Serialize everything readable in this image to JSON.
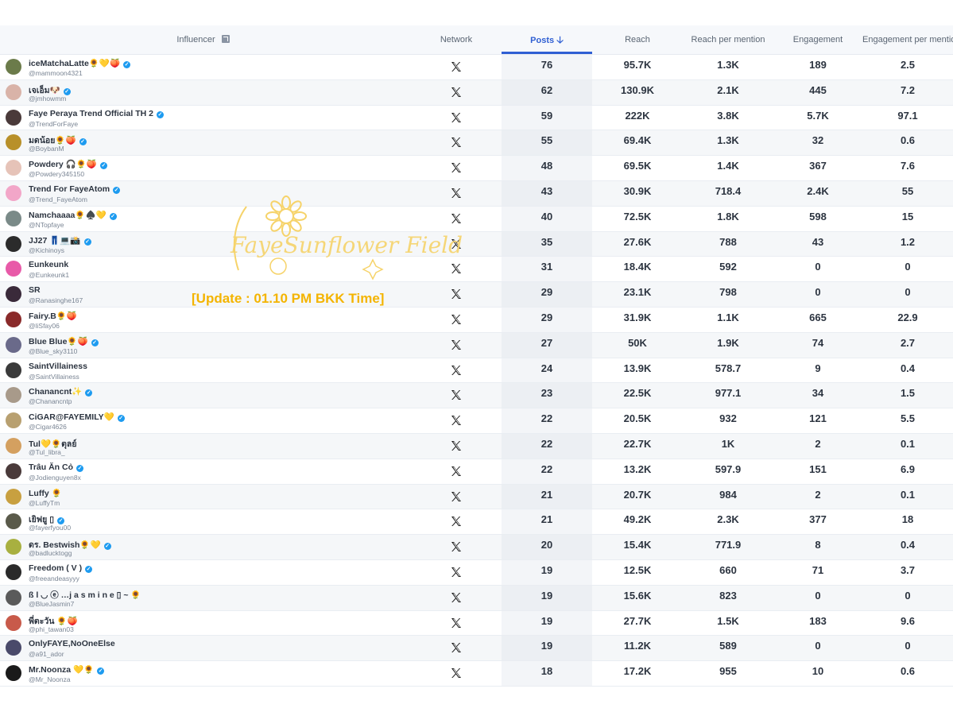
{
  "header": {
    "influencer": "Influencer",
    "network": "Network",
    "posts": "Posts",
    "reach": "Reach",
    "reach_per_mention": "Reach per mention",
    "engagement": "Engagement",
    "engagement_per_mention": "Engagement per mention"
  },
  "watermark": {
    "script_text": "FayeSunflower Field",
    "update_text": "[Update : 01.10 PM BKK Time]"
  },
  "network_icon": "x-logo-icon",
  "colors": {
    "accent": "#2f5fd3",
    "verified": "#1d9bf0",
    "update_text": "#f4b400"
  },
  "rows": [
    {
      "name": "iceMatchaLatte🌻💛🍑",
      "handle": "@mammoon4321",
      "verified": true,
      "posts": "76",
      "reach": "95.7K",
      "rpm": "1.3K",
      "eng": "189",
      "epm": "2.5",
      "avatar": "#6b7b4a"
    },
    {
      "name": "เจเอ็ม🐶",
      "handle": "@jmhowmm",
      "verified": true,
      "posts": "62",
      "reach": "130.9K",
      "rpm": "2.1K",
      "eng": "445",
      "epm": "7.2",
      "avatar": "#d9b3a8"
    },
    {
      "name": "Faye Peraya Trend Official TH 2",
      "handle": "@TrendForFaye",
      "verified": true,
      "posts": "59",
      "reach": "222K",
      "rpm": "3.8K",
      "eng": "5.7K",
      "epm": "97.1",
      "avatar": "#4a3a3a"
    },
    {
      "name": "มดน้อย🌻🍑",
      "handle": "@BoybanM",
      "verified": true,
      "posts": "55",
      "reach": "69.4K",
      "rpm": "1.3K",
      "eng": "32",
      "epm": "0.6",
      "avatar": "#b8902a"
    },
    {
      "name": "Powdery 🎧🌻🍑",
      "handle": "@Powdery345150",
      "verified": true,
      "posts": "48",
      "reach": "69.5K",
      "rpm": "1.4K",
      "eng": "367",
      "epm": "7.6",
      "avatar": "#e6c3b8"
    },
    {
      "name": "Trend For FayeAtom",
      "handle": "@Trend_FayeAtom",
      "verified": true,
      "posts": "43",
      "reach": "30.9K",
      "rpm": "718.4",
      "eng": "2.4K",
      "epm": "55",
      "avatar": "#f2a6c8"
    },
    {
      "name": "Namchaaaa🌻♠️💛",
      "handle": "@NTopfaye",
      "verified": true,
      "posts": "40",
      "reach": "72.5K",
      "rpm": "1.8K",
      "eng": "598",
      "epm": "15",
      "avatar": "#7a8a88"
    },
    {
      "name": "JJ27 👖💻📸",
      "handle": "@Kichinoys",
      "verified": true,
      "posts": "35",
      "reach": "27.6K",
      "rpm": "788",
      "eng": "43",
      "epm": "1.2",
      "avatar": "#2b2b2b"
    },
    {
      "name": "Eunkeunk",
      "handle": "@Eunkeunk1",
      "verified": false,
      "posts": "31",
      "reach": "18.4K",
      "rpm": "592",
      "eng": "0",
      "epm": "0",
      "avatar": "#e85aa8"
    },
    {
      "name": "SR",
      "handle": "@Ranasinghe167",
      "verified": false,
      "posts": "29",
      "reach": "23.1K",
      "rpm": "798",
      "eng": "0",
      "epm": "0",
      "avatar": "#3a2a3a"
    },
    {
      "name": "Fairy.B🌻🍑",
      "handle": "@liSfay06",
      "verified": false,
      "posts": "29",
      "reach": "31.9K",
      "rpm": "1.1K",
      "eng": "665",
      "epm": "22.9",
      "avatar": "#8a2a2a"
    },
    {
      "name": "Blue Blue🌻🍑",
      "handle": "@Blue_sky3110",
      "verified": true,
      "posts": "27",
      "reach": "50K",
      "rpm": "1.9K",
      "eng": "74",
      "epm": "2.7",
      "avatar": "#6a6a8a"
    },
    {
      "name": "SaintVillainess",
      "handle": "@SaintVillainess",
      "verified": false,
      "posts": "24",
      "reach": "13.9K",
      "rpm": "578.7",
      "eng": "9",
      "epm": "0.4",
      "avatar": "#3a3a3a"
    },
    {
      "name": "Chanancnt✨",
      "handle": "@Chanancntp",
      "verified": true,
      "posts": "23",
      "reach": "22.5K",
      "rpm": "977.1",
      "eng": "34",
      "epm": "1.5",
      "avatar": "#a89a8a"
    },
    {
      "name": "CiGAR@FAYEMILY💛",
      "handle": "@Cigar4626",
      "verified": true,
      "posts": "22",
      "reach": "20.5K",
      "rpm": "932",
      "eng": "121",
      "epm": "5.5",
      "avatar": "#b8a070"
    },
    {
      "name": "Tul💛🌻ตุลย์",
      "handle": "@Tul_libra_",
      "verified": false,
      "posts": "22",
      "reach": "22.7K",
      "rpm": "1K",
      "eng": "2",
      "epm": "0.1",
      "avatar": "#d4a060"
    },
    {
      "name": "Trâu Ăn Cỏ",
      "handle": "@Jodienguyen8x",
      "verified": true,
      "posts": "22",
      "reach": "13.2K",
      "rpm": "597.9",
      "eng": "151",
      "epm": "6.9",
      "avatar": "#4a3a3a"
    },
    {
      "name": "Luffy 🌻",
      "handle": "@LuffyTm",
      "verified": false,
      "posts": "21",
      "reach": "20.7K",
      "rpm": "984",
      "eng": "2",
      "epm": "0.1",
      "avatar": "#c8a040"
    },
    {
      "name": "เยิฟยู ▯",
      "handle": "@fayerfyou00",
      "verified": true,
      "posts": "21",
      "reach": "49.2K",
      "rpm": "2.3K",
      "eng": "377",
      "epm": "18",
      "avatar": "#5a5a4a"
    },
    {
      "name": "ดร. Bestwish🌻💛",
      "handle": "@badlucktogg",
      "verified": true,
      "posts": "20",
      "reach": "15.4K",
      "rpm": "771.9",
      "eng": "8",
      "epm": "0.4",
      "avatar": "#a8b040"
    },
    {
      "name": "Freedom ( V )",
      "handle": "@freeandeasyyy",
      "verified": true,
      "posts": "19",
      "reach": "12.5K",
      "rpm": "660",
      "eng": "71",
      "epm": "3.7",
      "avatar": "#2a2a2a"
    },
    {
      "name": "ß l ◡ ⓔ …j a s m i n e ▯ ~ 🌻",
      "handle": "@BlueJasmin7",
      "verified": false,
      "posts": "19",
      "reach": "15.6K",
      "rpm": "823",
      "eng": "0",
      "epm": "0",
      "avatar": "#5a5a5a"
    },
    {
      "name": "พี่ตะวัน 🌻🍑",
      "handle": "@phi_tawan03",
      "verified": false,
      "posts": "19",
      "reach": "27.7K",
      "rpm": "1.5K",
      "eng": "183",
      "epm": "9.6",
      "avatar": "#c85a4a"
    },
    {
      "name": "OnlyFAYE,NoOneElse",
      "handle": "@a91_ador",
      "verified": false,
      "posts": "19",
      "reach": "11.2K",
      "rpm": "589",
      "eng": "0",
      "epm": "0",
      "avatar": "#4a4a6a"
    },
    {
      "name": "Mr.Noonza 💛🌻",
      "handle": "@Mr_Noonza",
      "verified": true,
      "posts": "18",
      "reach": "17.2K",
      "rpm": "955",
      "eng": "10",
      "epm": "0.6",
      "avatar": "#1a1a1a"
    }
  ]
}
